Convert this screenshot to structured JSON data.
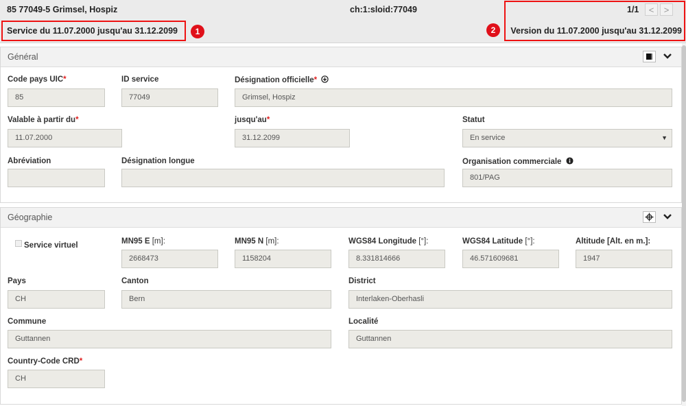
{
  "header": {
    "title": "85 77049-5 Grimsel, Hospiz",
    "sloid": "ch:1:sloid:77049",
    "validity": "Service du 11.07.2000 jusqu'au 31.12.2099",
    "version": "Version du 11.07.2000 jusqu'au 31.12.2099",
    "page": "1/1",
    "prev_icon": "<",
    "next_icon": ">",
    "badge_1": "1",
    "badge_2": "2"
  },
  "general": {
    "title": "Général",
    "uic_label": "Code pays UIC",
    "uic_value": "85",
    "id_label": "ID service",
    "id_value": "77049",
    "designation_label": "Désignation officielle",
    "designation_value": "Grimsel, Hospiz",
    "valid_from_label": "Valable à partir du",
    "valid_from_value": "11.07.2000",
    "valid_to_label": "jusqu'au",
    "valid_to_value": "31.12.2099",
    "status_label": "Statut",
    "status_value": "En service",
    "abbr_label": "Abréviation",
    "abbr_value": "",
    "long_label": "Désignation longue",
    "long_value": "",
    "org_label": "Organisation commerciale",
    "org_value": "801/PAG",
    "required_mark": "*"
  },
  "geo": {
    "title": "Géographie",
    "virtual_label": "Service virtuel",
    "mn95e_label_a": "MN95 ",
    "mn95e_label_b": "E",
    "mn95e_label_c": " [m]:",
    "mn95e_value": "2668473",
    "mn95n_label_a": "MN95 ",
    "mn95n_label_b": "N",
    "mn95n_label_c": " [m]:",
    "mn95n_value": "1158204",
    "lon_label_a": "WGS84 ",
    "lon_label_b": "Longitude",
    "lon_label_c": " [°]:",
    "lon_value": "8.331814666",
    "lat_label_a": "WGS84 ",
    "lat_label_b": "Latitude",
    "lat_label_c": " [°]:",
    "lat_value": "46.571609681",
    "alt_label": "Altitude [Alt. en m.]:",
    "alt_value": "1947",
    "country_label": "Pays",
    "country_value": "CH",
    "canton_label": "Canton",
    "canton_value": "Bern",
    "district_label": "District",
    "district_value": "Interlaken-Oberhasli",
    "commune_label": "Commune",
    "commune_value": "Guttannen",
    "locality_label": "Localité",
    "locality_value": "Guttannen",
    "crd_label": "Country-Code CRD",
    "crd_value": "CH"
  },
  "icons": {
    "download": "download-circle-icon",
    "info": "info-circle-icon",
    "book": "book-icon",
    "crosshair": "crosshair-icon",
    "chevron": "chevron-down-icon"
  }
}
